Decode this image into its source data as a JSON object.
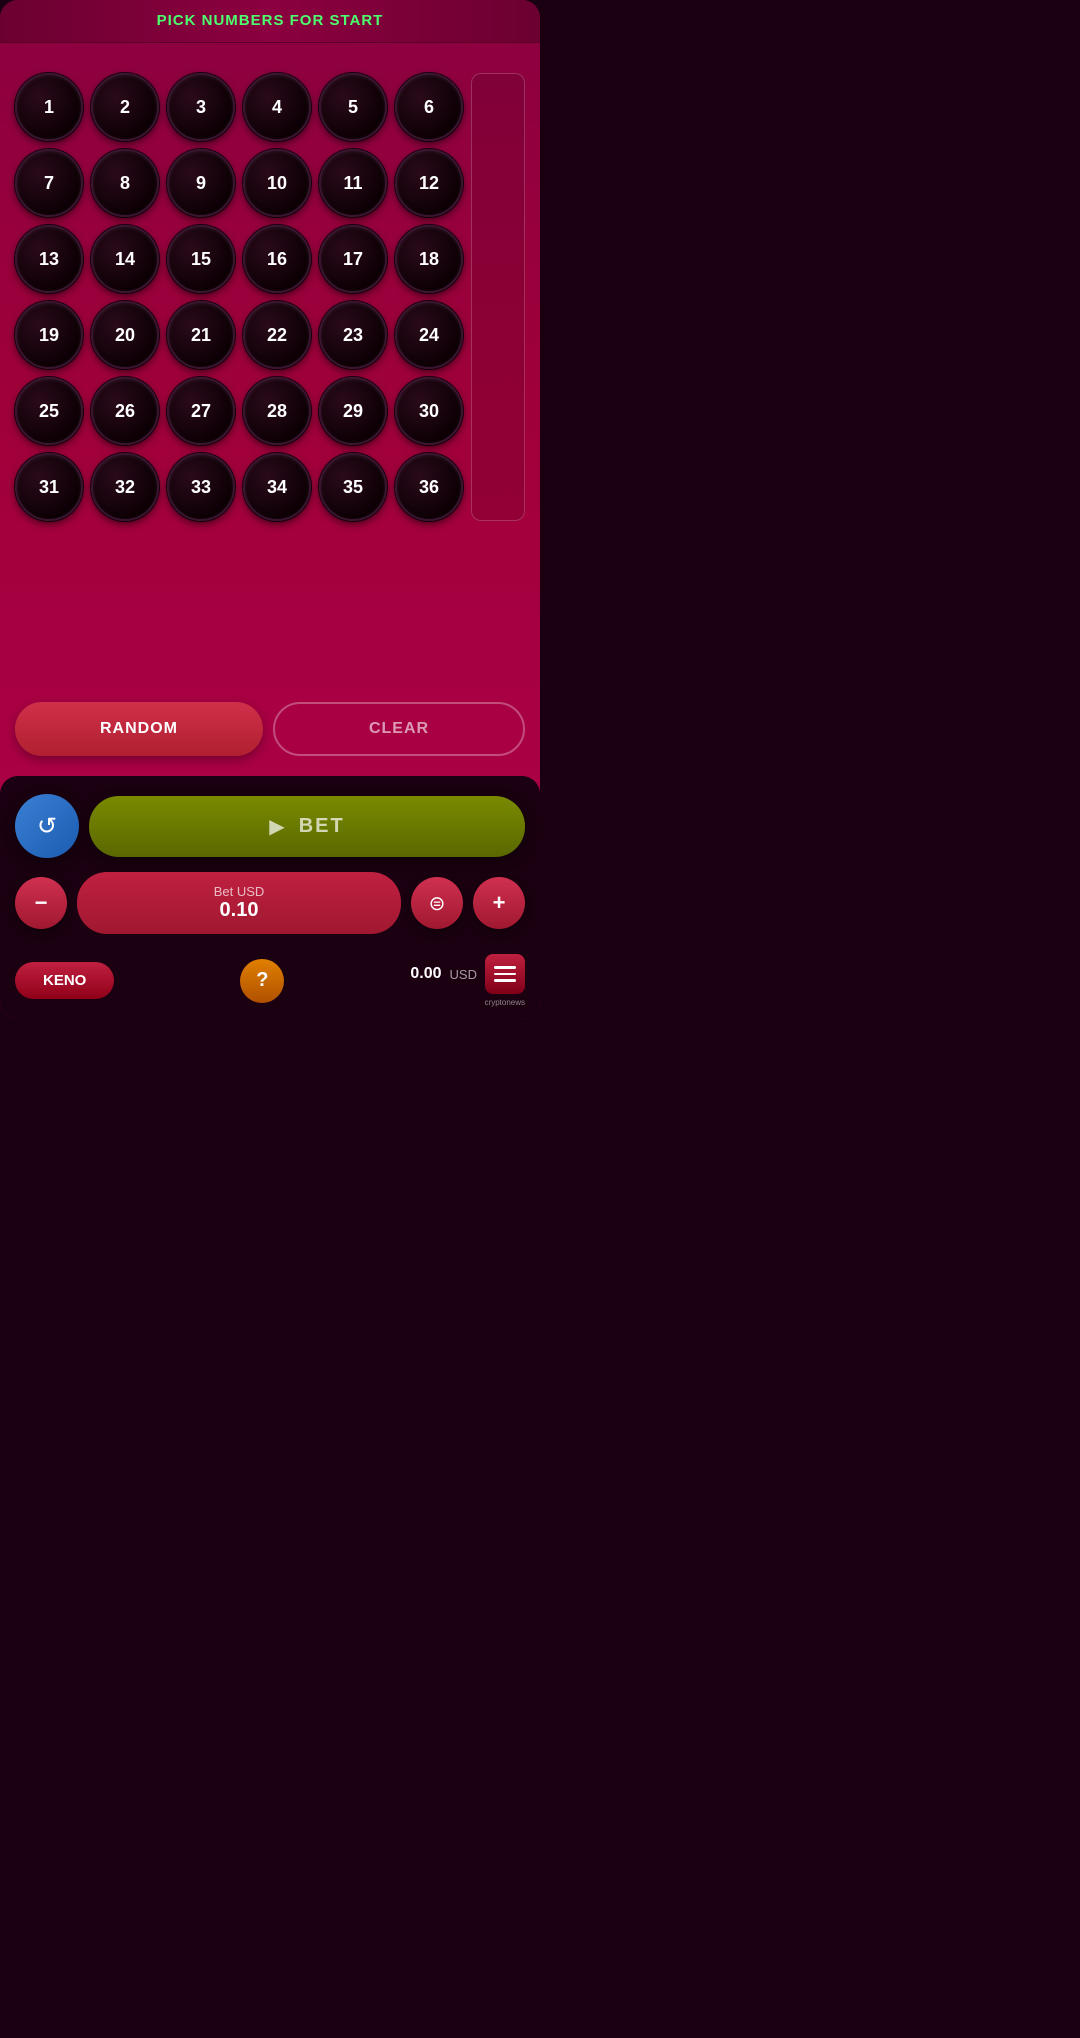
{
  "header": {
    "title": "PICK NUMBERS FOR START"
  },
  "numbers": {
    "grid": [
      1,
      2,
      3,
      4,
      5,
      6,
      7,
      8,
      9,
      10,
      11,
      12,
      13,
      14,
      15,
      16,
      17,
      18,
      19,
      20,
      21,
      22,
      23,
      24,
      25,
      26,
      27,
      28,
      29,
      30,
      31,
      32,
      33,
      34,
      35,
      36
    ]
  },
  "actions": {
    "random_label": "RANDOM",
    "clear_label": "CLEAR"
  },
  "bet": {
    "replay_label": "↺",
    "bet_label": "BET",
    "bet_usd_label": "Bet USD",
    "bet_amount": "0.10",
    "minus_label": "−",
    "chips_label": "⊜",
    "plus_label": "+"
  },
  "footer": {
    "keno_label": "KENO",
    "help_label": "?",
    "balance_amount": "0.00",
    "balance_currency": "USD",
    "menu_label": "≡",
    "cryptonews": "cryptonews"
  },
  "colors": {
    "primary_bg": "#8b0040",
    "ball_bg": "#0d0005",
    "accent_green": "#4cff6e",
    "bet_btn_bg": "#6a7800",
    "bottom_panel_bg": "#1a0010"
  }
}
